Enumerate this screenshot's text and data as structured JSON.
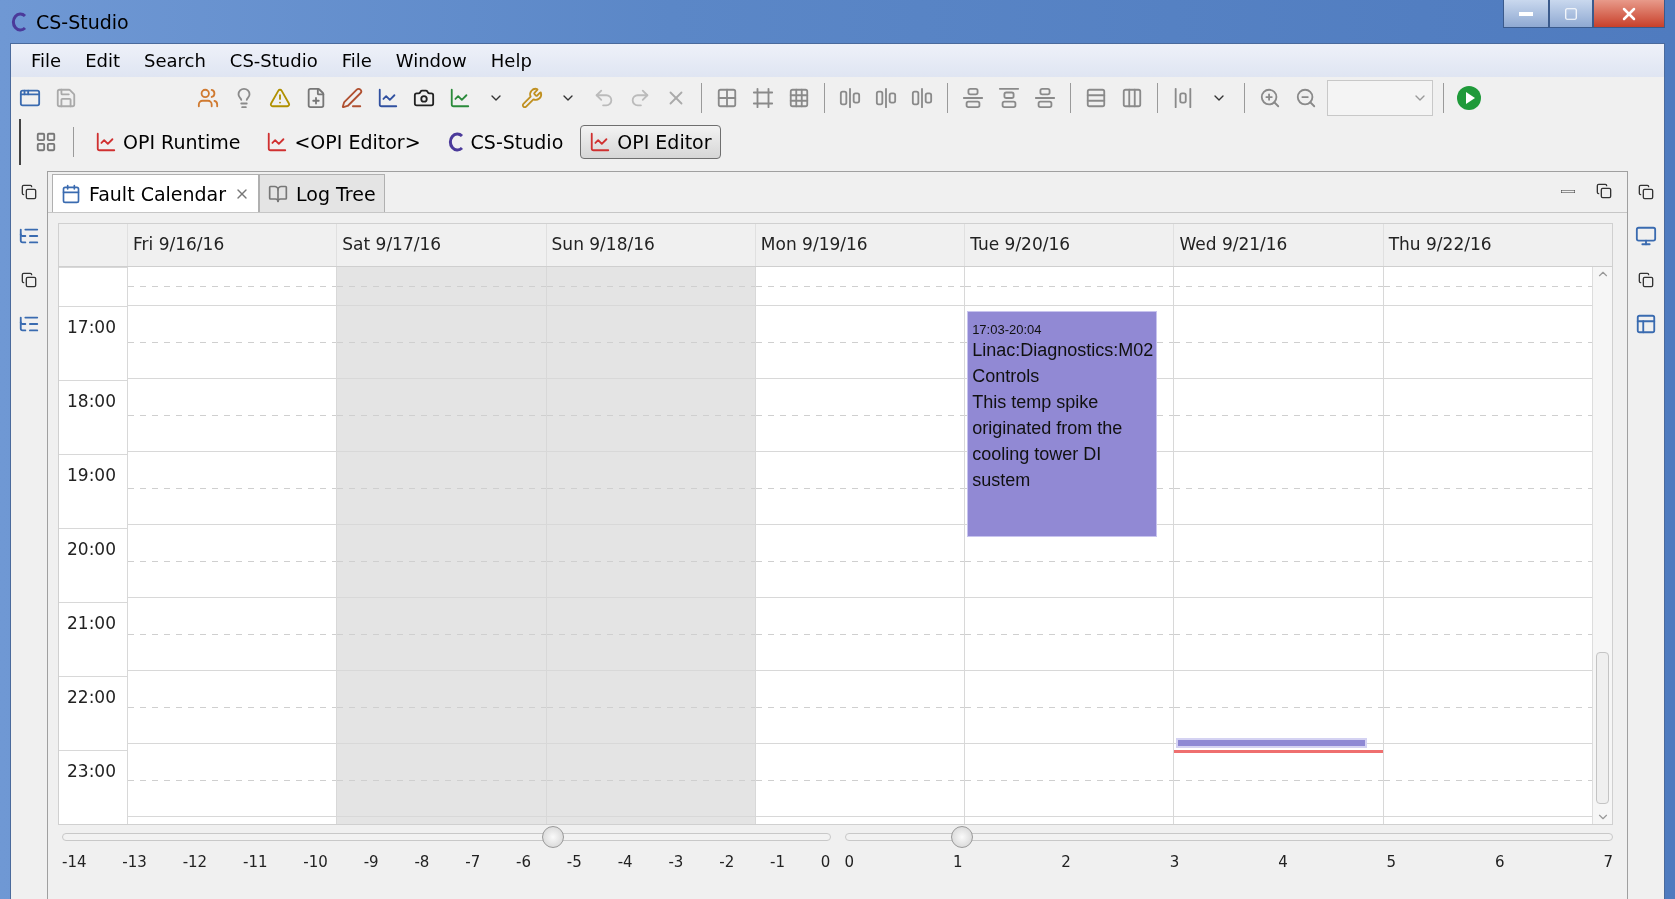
{
  "window": {
    "title": "CS-Studio"
  },
  "menu": [
    "File",
    "Edit",
    "Search",
    "CS-Studio",
    "File",
    "Window",
    "Help"
  ],
  "perspectives": [
    {
      "label": "OPI Runtime",
      "kind": "opi",
      "selected": false
    },
    {
      "label": "<OPI Editor>",
      "kind": "opi",
      "selected": false
    },
    {
      "label": "CS-Studio",
      "kind": "studio",
      "selected": false
    },
    {
      "label": "OPI Editor",
      "kind": "opi",
      "selected": true
    }
  ],
  "tabs": [
    {
      "label": "Fault Calendar",
      "kind": "calendar",
      "selected": true,
      "closable": true
    },
    {
      "label": "Log Tree",
      "kind": "tree",
      "selected": false,
      "closable": false
    }
  ],
  "calendar": {
    "days": [
      {
        "label": "Fri 9/16/16",
        "weekend": false,
        "today": false
      },
      {
        "label": "Sat 9/17/16",
        "weekend": true,
        "today": false
      },
      {
        "label": "Sun 9/18/16",
        "weekend": true,
        "today": false
      },
      {
        "label": "Mon 9/19/16",
        "weekend": false,
        "today": false
      },
      {
        "label": "Tue 9/20/16",
        "weekend": false,
        "today": false,
        "events": [
          {
            "kind": "block",
            "time": "17:03-20:04",
            "lines": [
              "Linac:Diagnostics:M02",
              "Controls",
              "This temp spike originated from the cooling tower DI sustem"
            ]
          }
        ]
      },
      {
        "label": "Wed 9/21/16",
        "weekend": false,
        "today": true,
        "events": [
          {
            "kind": "marker"
          }
        ]
      },
      {
        "label": "Thu 9/22/16",
        "weekend": false,
        "today": false
      }
    ],
    "hours": [
      "17:00",
      "18:00",
      "19:00",
      "20:00",
      "21:00",
      "22:00",
      "23:00"
    ]
  },
  "sliders": [
    {
      "level": 0.643,
      "ticks": [
        "-14",
        "-13",
        "-12",
        "-11",
        "-10",
        "-9",
        "-8",
        "-7",
        "-6",
        "-5",
        "-4",
        "-3",
        "-2",
        "-1",
        "0"
      ]
    },
    {
      "level": 0.143,
      "ticks": [
        "0",
        "1",
        "2",
        "3",
        "4",
        "5",
        "6",
        "7"
      ]
    }
  ]
}
